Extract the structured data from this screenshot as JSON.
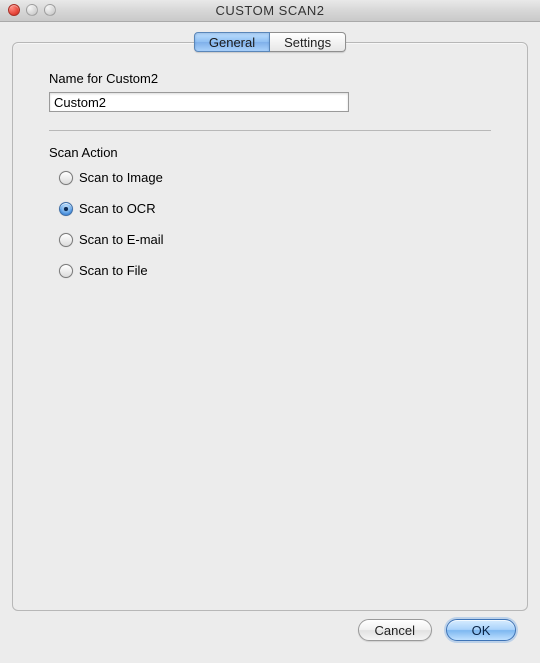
{
  "window": {
    "title": "CUSTOM SCAN2"
  },
  "tabs": {
    "general": "General",
    "settings": "Settings",
    "active": "general"
  },
  "name_field": {
    "label": "Name for Custom2",
    "value": "Custom2"
  },
  "scan_action": {
    "label": "Scan Action",
    "options": [
      {
        "id": "image",
        "label": "Scan to Image"
      },
      {
        "id": "ocr",
        "label": "Scan to OCR"
      },
      {
        "id": "email",
        "label": "Scan to E-mail"
      },
      {
        "id": "file",
        "label": "Scan to File"
      }
    ],
    "selected": "ocr"
  },
  "buttons": {
    "cancel": "Cancel",
    "ok": "OK"
  }
}
